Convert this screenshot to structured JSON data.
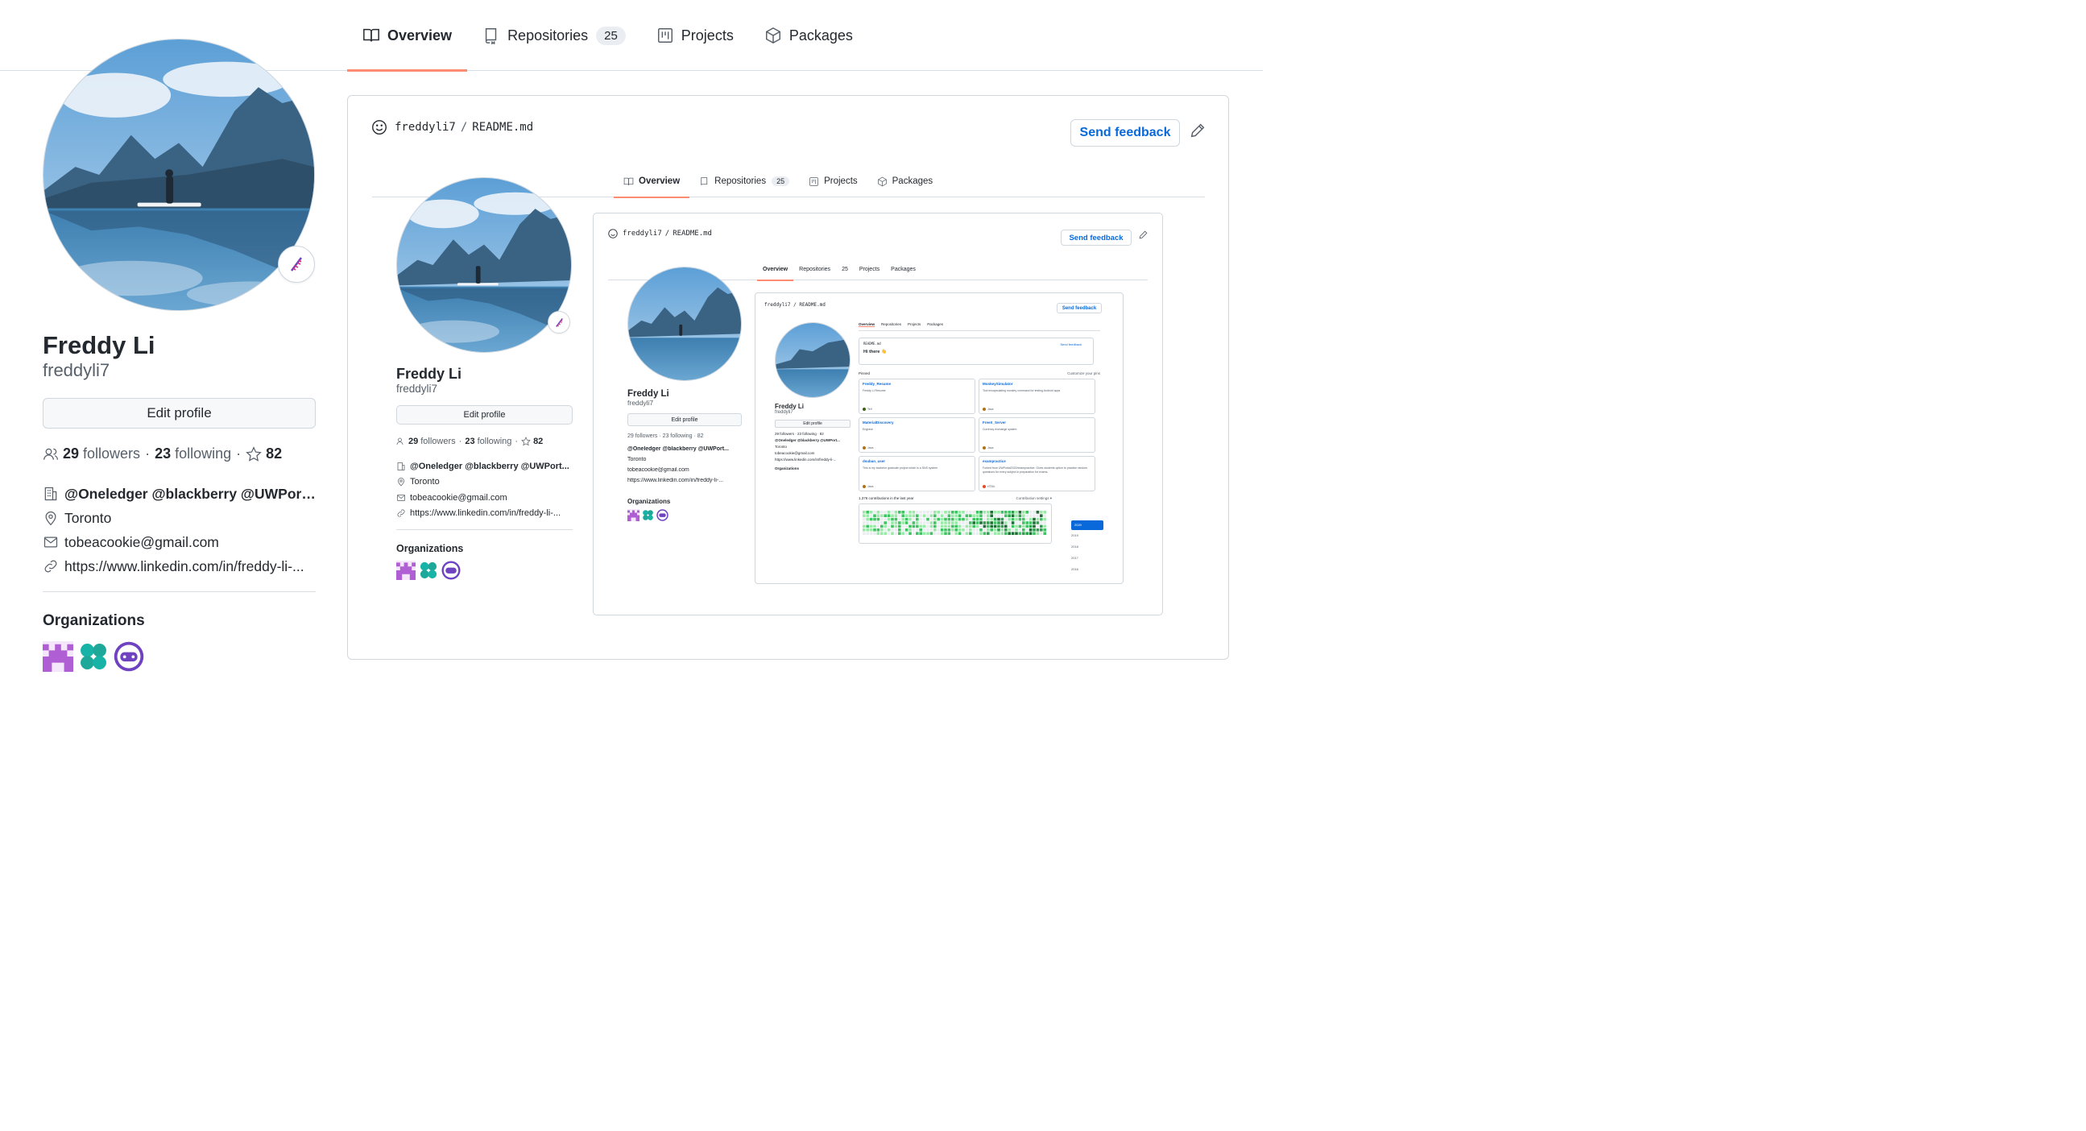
{
  "nav": {
    "tabs": [
      {
        "label": "Overview",
        "active": true
      },
      {
        "label": "Repositories",
        "count": "25"
      },
      {
        "label": "Projects"
      },
      {
        "label": "Packages"
      }
    ]
  },
  "profile": {
    "name": "Freddy Li",
    "login": "freddyli7",
    "edit_label": "Edit profile",
    "followers_count": "29",
    "followers_label": "followers",
    "following_count": "23",
    "following_label": "following",
    "separator": "·",
    "stars": "82",
    "company": "@Oneledger @blackberry @UWPort...",
    "location": "Toronto",
    "email": "tobeacookie@gmail.com",
    "website": "https://www.linkedin.com/in/freddy-li-...",
    "orgs_title": "Organizations"
  },
  "readme": {
    "owner": "freddyli7",
    "slash": "/",
    "file": "README.md",
    "feedback_label": "Send feedback"
  },
  "nested": {
    "company": "@Oneledger @blackberry @UWPort...",
    "website": "https://www.linkedin.com/in/freddy-li-...",
    "n3_company": "@Oneledger @blackberry @UWPort...",
    "n3_website": "https://www.linkedin.com/in/freddy-li-...",
    "n4_company": "@Oneledger @blackberry @UWPort...",
    "n4_website": "https://www.linkedin.com/in/freddy-li-...",
    "followers_line": "29 followers · 23 following · 82",
    "hi_there": "Hi there 👋",
    "pinned_label": "Pinned",
    "customize_label": "Customize your pins",
    "pinned": [
      {
        "name": "Freddy_Resume",
        "desc": "Freddy Li Resume",
        "lang": "TeX",
        "color": "#3D6117"
      },
      {
        "name": "MonkeySimulator",
        "desc": "Tool encapsulating monkey command for testing Android apps",
        "lang": "Java",
        "color": "#b07219"
      },
      {
        "name": "MaterialDiscovery",
        "desc": "Engrave",
        "lang": "Java",
        "color": "#b07219"
      },
      {
        "name": "FreeX_Server",
        "desc": "Currency exchange system",
        "lang": "Java",
        "color": "#b07219"
      },
      {
        "name": "dsuban_user",
        "desc": "This is my bachelor graduate project which is a SNS system",
        "lang": "Java",
        "color": "#b07219"
      },
      {
        "name": "exampractice",
        "desc": "Forked from UWPortal2020/exampractice. Gives students option to practice random questions for every subject in preparation for exams.",
        "lang": "HTML",
        "color": "#e34c26"
      }
    ],
    "contrib_label": "1,376 contributions in the last year",
    "contrib_settings": "Contribution settings ▾",
    "years": [
      "2020",
      "2019",
      "2018",
      "2017",
      "2016"
    ]
  },
  "colors": {
    "accent": "#fd8c73",
    "link": "#0969da",
    "org1": "#b05ed3",
    "org2": "#17b3a6",
    "org3": "#6f42c1"
  }
}
